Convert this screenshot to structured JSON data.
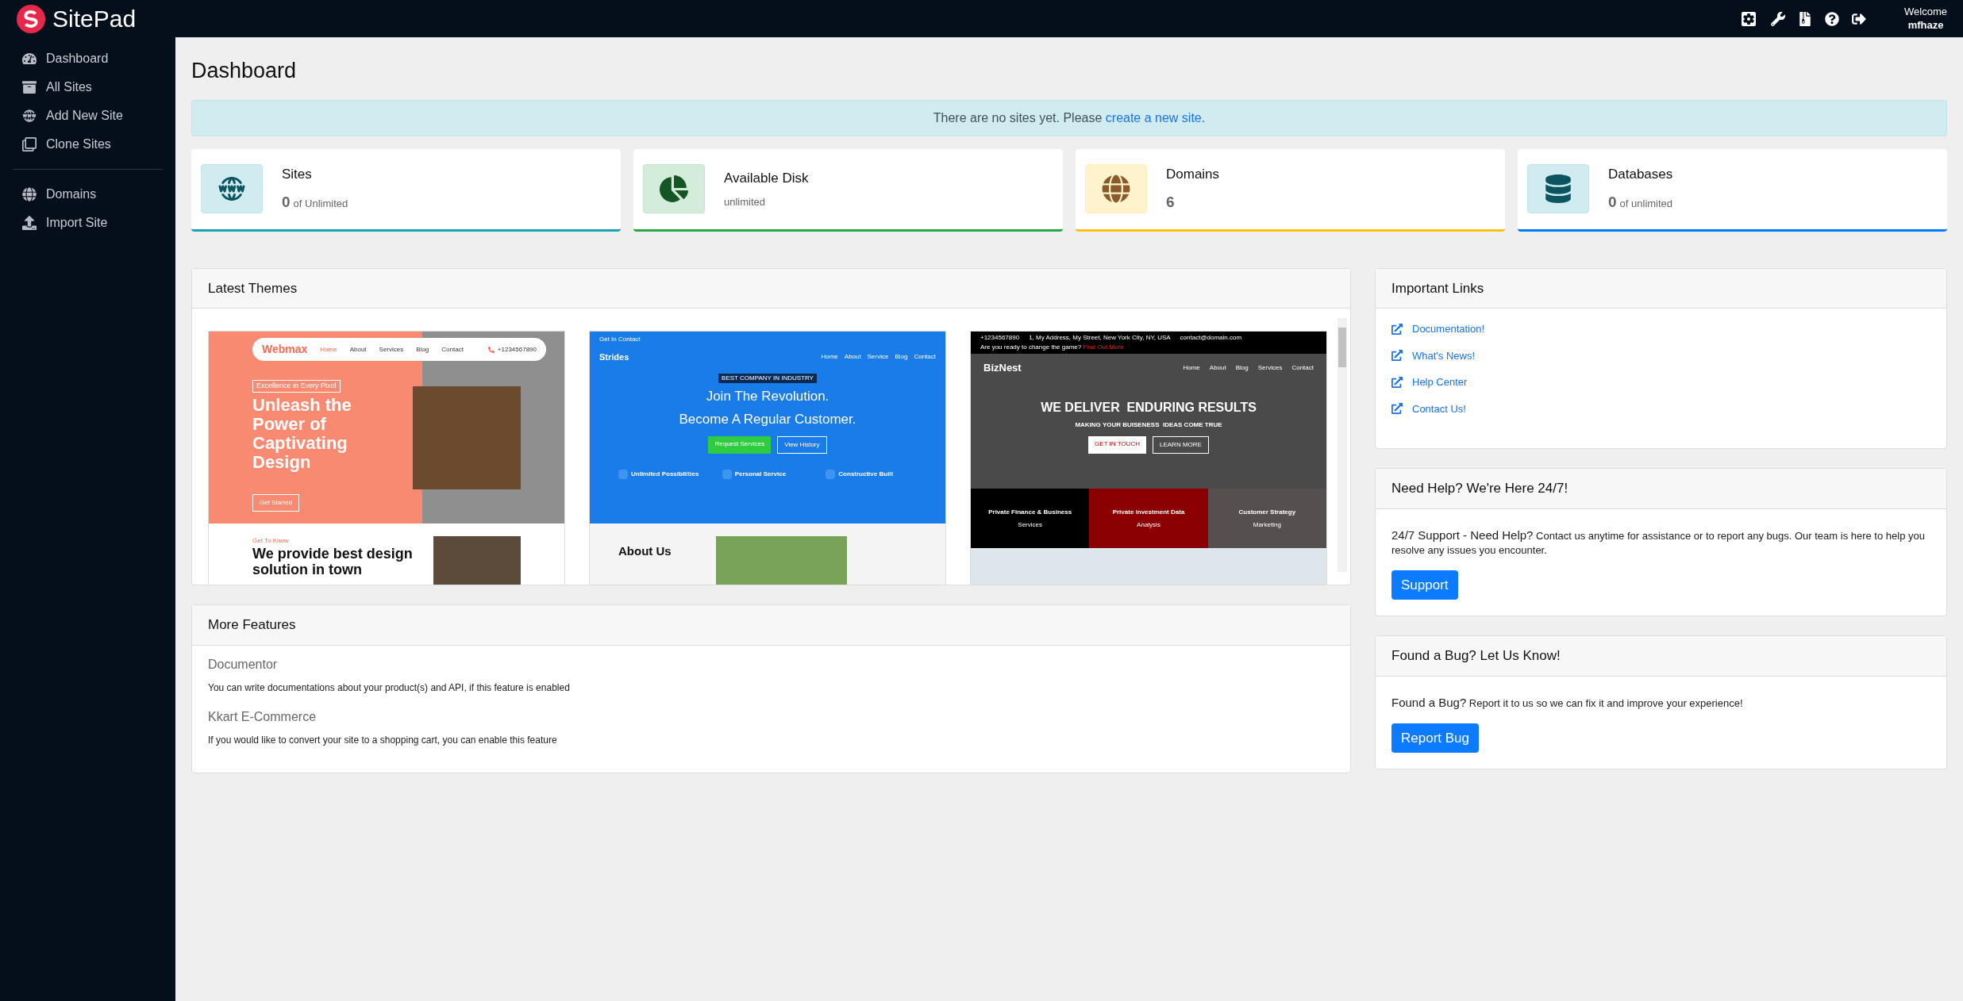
{
  "app": {
    "name": "SitePad"
  },
  "topbar": {
    "welcome": "Welcome",
    "user": "mfhaze"
  },
  "sidebar": {
    "groups": [
      [
        {
          "label": "Dashboard"
        },
        {
          "label": "All Sites"
        },
        {
          "label": "Add New Site"
        },
        {
          "label": "Clone Sites"
        }
      ],
      [
        {
          "label": "Domains"
        },
        {
          "label": "Import Site"
        }
      ]
    ]
  },
  "page_title": "Dashboard",
  "alert": {
    "text": "There are no sites yet. Please ",
    "link": "create a new site",
    "end": "."
  },
  "stats": [
    {
      "title": "Sites",
      "value": "0",
      "detail": "of Unlimited",
      "color": "#17a2b8"
    },
    {
      "title": "Available Disk",
      "detail": "unlimited",
      "color": "#28a745"
    },
    {
      "title": "Domains",
      "value": "6",
      "color": "#ffc107"
    },
    {
      "title": "Databases",
      "value": "0",
      "detail": "of unlimited",
      "color": "#007bff"
    }
  ],
  "latest_themes": {
    "title": "Latest Themes",
    "themes": [
      {
        "brand": "Webmax",
        "nav": [
          "Home",
          "About",
          "Services",
          "Blog",
          "Contact"
        ],
        "phone": "+1234567890",
        "tag": "Excellence in Every Pixel",
        "headline": "Unleash the Power of Captivating Design",
        "button": "Get Started",
        "section_tag": "Get To Know",
        "section_title": "We provide best design solution in town"
      },
      {
        "brand": "Strides",
        "top": "Get In Contact",
        "nav": [
          "Home",
          "About",
          "Service",
          "Blog",
          "Contact"
        ],
        "badge": "BEST COMPANY IN INDUSTRY",
        "headline": "Join The Revolution.",
        "headline2": "Become A Regular Customer.",
        "buttons": [
          "Request Services",
          "View History"
        ],
        "features": [
          "Unlimited Possibilities",
          "Personal Service",
          "Constructive Built"
        ],
        "section_title": "About Us"
      },
      {
        "brand": "BizNest",
        "top": [
          "+1234567890",
          "1, My Address, My Street, New York City, NY, USA",
          "contact@domain.com"
        ],
        "cta_text": "Are you ready to change the game?",
        "cta_link": "Find Out More",
        "nav": [
          "Home",
          "About",
          "Blog",
          "Services",
          "Contact"
        ],
        "headline": "WE DELIVER  ENDURING RESULTS",
        "subline": "MAKING YOUR BUISENESS  IDEAS COME TRUE",
        "buttons": [
          "GET IN TOUCH",
          "LEARN MORE"
        ],
        "tiles": [
          {
            "title": "Private Finance & Business",
            "sub": "Services",
            "color": "#000000"
          },
          {
            "title": "Private Investment Data",
            "sub": "Analysis",
            "color": "#8b0000"
          },
          {
            "title": "Customer Strategy",
            "sub": "Marketing",
            "color": "#55504f"
          }
        ]
      }
    ]
  },
  "more_features": {
    "title": "More Features",
    "items": [
      {
        "name": "Documentor",
        "description": "You can write documentations about your product(s) and API, if this feature is enabled"
      },
      {
        "name": "Kkart E-Commerce",
        "description": "If you would like to convert your site to a shopping cart, you can enable this feature"
      }
    ]
  },
  "important_links": {
    "title": "Important Links",
    "links": [
      "Documentation!",
      "What's News!",
      "Help Center",
      "Contact Us!"
    ]
  },
  "help": {
    "title": "Need Help? We're Here 24/7!",
    "text": "**24/7 Support - Need Help?** Contact us anytime for assistance or to report any bugs. Our team is here to help you resolve any issues you encounter.",
    "button": "Support"
  },
  "bug": {
    "title": "Found a Bug? Let Us Know!",
    "text": "**Found a Bug?** Report it to us so we can fix it and improve your experience!",
    "button": "Report Bug"
  }
}
